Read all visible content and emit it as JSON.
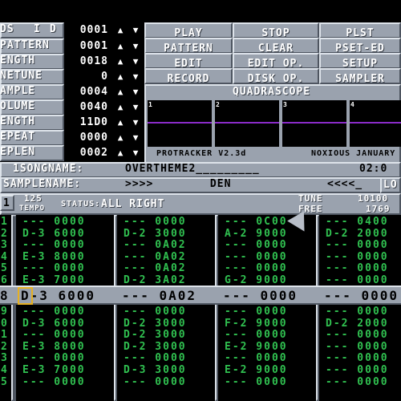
{
  "header": {
    "pos_label": "DS",
    "i_label": "I",
    "d_label": "D",
    "rows": [
      {
        "label": "PATTERN",
        "value": "0001"
      },
      {
        "label": "ENGTH",
        "value": "0018"
      },
      {
        "label": "NETUNE",
        "value": "0"
      },
      {
        "label": "AMPLE",
        "value": "0004"
      },
      {
        "label": "OLUME",
        "value": "0040"
      },
      {
        "label": "ENGTH",
        "value": "11D0"
      },
      {
        "label": "EPEAT",
        "value": "0000"
      },
      {
        "label": "EPLEN",
        "value": "0002"
      }
    ],
    "pos_value": "0001"
  },
  "buttons": {
    "row1": [
      "PLAY",
      "STOP",
      "PLST"
    ],
    "row2": [
      "PATTERN",
      "CLEAR",
      "PSET-ED"
    ],
    "row3": [
      "EDIT",
      "EDIT OP.",
      "SETUP"
    ],
    "row4": [
      "RECORD",
      "DISK OP.",
      "SAMPLER"
    ]
  },
  "quadrascope": {
    "title": "QUADRASCOPE",
    "channels": [
      "1",
      "2",
      "3",
      "4"
    ]
  },
  "info": {
    "version": "PROTRACKER V2.3d",
    "credit": "NOXIOUS JANUARY 1"
  },
  "songname": {
    "label": "1SONGNAME:",
    "value": "OVERTHEME2_________",
    "time": "02:0"
  },
  "samplename": {
    "label": "SAMPLENAME:",
    "value": ">>>>        DEN",
    "tail": "<<<<_",
    "lo": "LO"
  },
  "status": {
    "channel": "1",
    "tempo_value": "125",
    "tempo_label": "TEMPO",
    "status_label": "STATUS:",
    "status_value": "ALL RIGHT",
    "tune_label": "TUNE",
    "tune_value": "10100",
    "free_label": "FREE",
    "free_value": "1769"
  },
  "pattern": {
    "rows_top": [
      {
        "n": "1",
        "c": [
          "--- 0000",
          "--- 0000",
          "--- 0C00",
          "--- 0400"
        ]
      },
      {
        "n": "2",
        "c": [
          "D-3 6000",
          "D-2 3000",
          "A-2 9000",
          "D-2 2000"
        ]
      },
      {
        "n": "3",
        "c": [
          "--- 0000",
          "--- 0A02",
          "--- 0000",
          "--- 0000"
        ]
      },
      {
        "n": "4",
        "c": [
          "E-3 8000",
          "--- 0A02",
          "--- 0000",
          "--- 0000"
        ]
      },
      {
        "n": "5",
        "c": [
          "--- 0000",
          "--- 0A02",
          "--- 0000",
          "--- 0000"
        ]
      },
      {
        "n": "6",
        "c": [
          "E-3 7000",
          "D-2 3A02",
          "G-2 9000",
          "--- 0000"
        ]
      },
      {
        "n": "7",
        "c": [
          "--- 0000",
          "--- 0A02",
          "--- 0000",
          "--- 0000"
        ]
      }
    ],
    "current": {
      "n": "8",
      "c": [
        "D-3 6000",
        "--- 0A02",
        "--- 0000",
        "--- 0000"
      ]
    },
    "rows_bottom": [
      {
        "n": "9",
        "c": [
          "--- 0000",
          "--- 0000",
          "--- 0000",
          "--- 0000"
        ]
      },
      {
        "n": "0",
        "c": [
          "D-3 6000",
          "D-2 3000",
          "F-2 9000",
          "D-2 2000"
        ]
      },
      {
        "n": "1",
        "c": [
          "--- 0000",
          "D-2 3000",
          "--- 0000",
          "--- 0000"
        ]
      },
      {
        "n": "2",
        "c": [
          "E-3 8000",
          "D-2 3000",
          "E-2 9000",
          "--- 0000"
        ]
      },
      {
        "n": "3",
        "c": [
          "--- 0000",
          "--- 0000",
          "--- 0000",
          "--- 0000"
        ]
      },
      {
        "n": "4",
        "c": [
          "E-3 7000",
          "D-3 3000",
          "E-2 9000",
          "--- 0000"
        ]
      },
      {
        "n": "5",
        "c": [
          "--- 0000",
          "--- 0000",
          "--- 0000",
          "--- 0000"
        ]
      }
    ]
  },
  "colors": {
    "panel": "#9aa2ae",
    "note": "#30c050",
    "scope": "#8a2bc8"
  }
}
